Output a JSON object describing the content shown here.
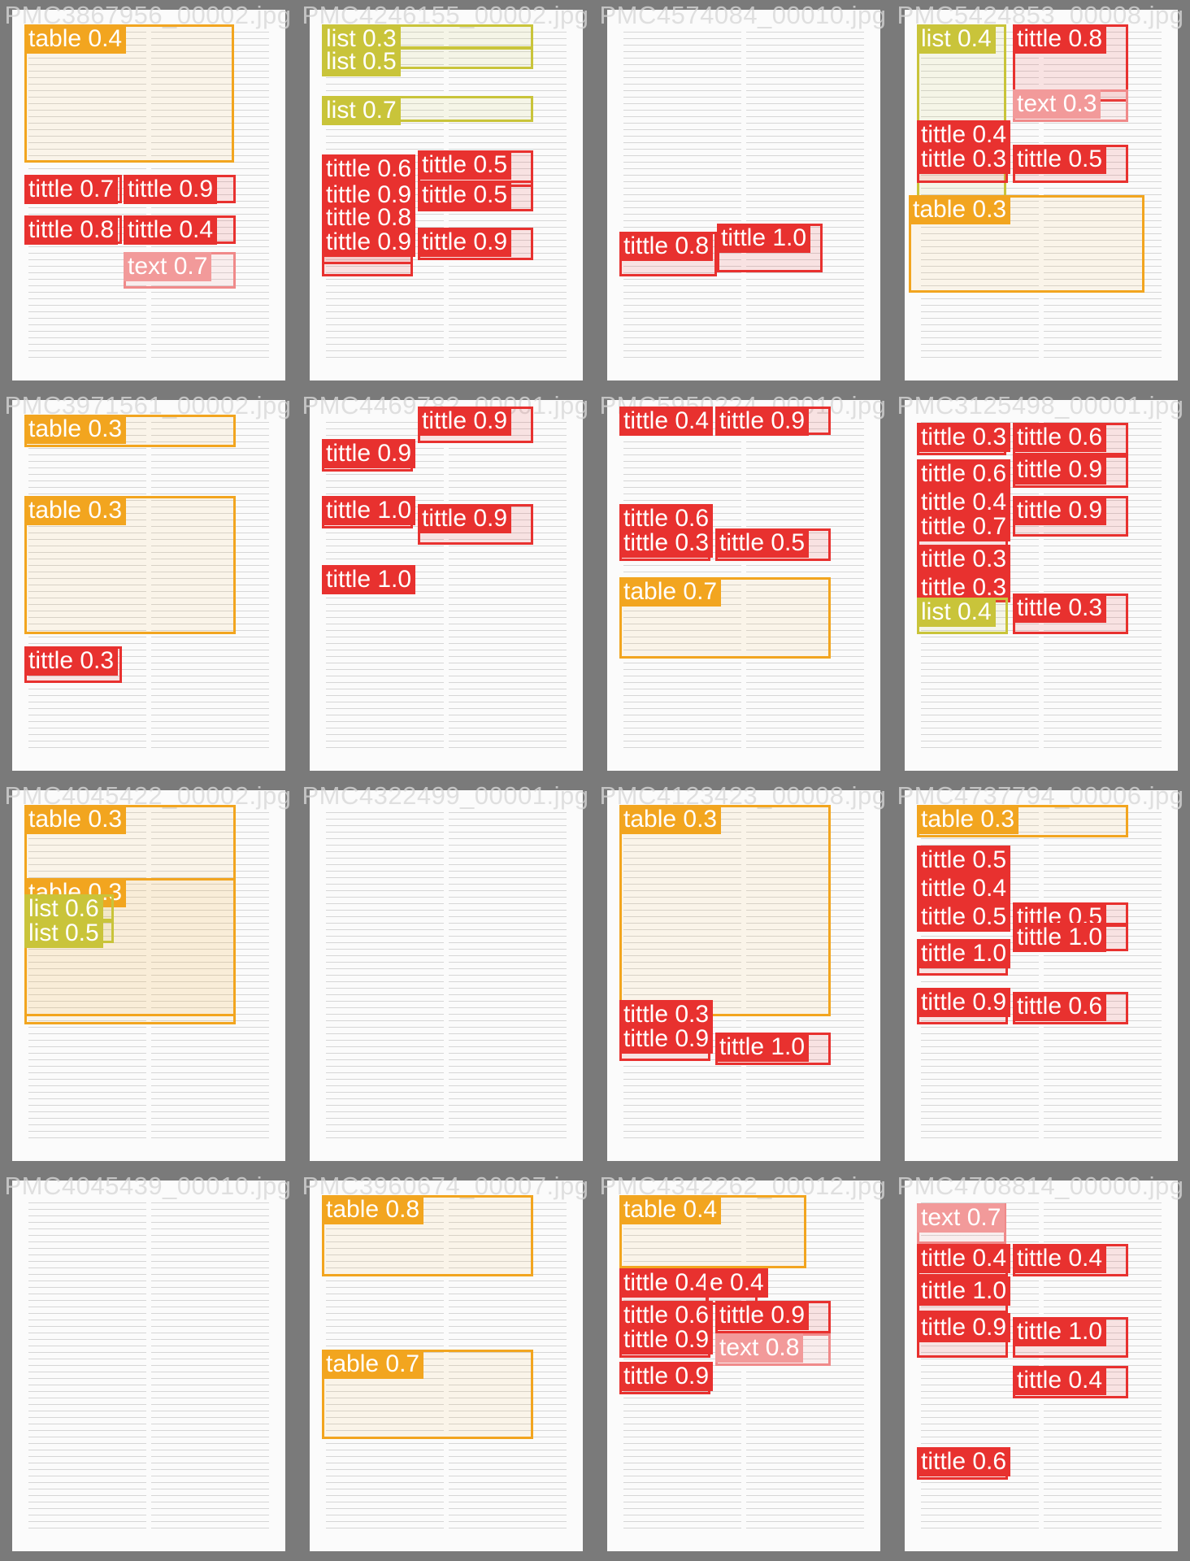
{
  "colors": {
    "title": "#e8312f",
    "table": "#f2a51f",
    "list": "#c9c43a",
    "text": "#f08a8a",
    "cell_background": "#7a7a7a"
  },
  "cells": [
    {
      "name": "PMC3867956_00002.jpg",
      "regions": [
        {
          "label": "table 0.4",
          "class": "orange"
        },
        {
          "label": "tittle 0.7",
          "class": "red"
        },
        {
          "label": "tittle 0.9",
          "class": "red"
        },
        {
          "label": "tittle 0.8",
          "class": "red"
        },
        {
          "label": "tittle 0.4",
          "class": "red"
        },
        {
          "label": "text 0.7",
          "class": "pink"
        }
      ]
    },
    {
      "name": "PMC4246155_00002.jpg",
      "regions": [
        {
          "label": "list 0.3",
          "class": "olive"
        },
        {
          "label": "list 0.5",
          "class": "olive"
        },
        {
          "label": "list 0.7",
          "class": "olive"
        },
        {
          "label": "tittle 0.6",
          "class": "red"
        },
        {
          "label": "tittle 0.5",
          "class": "red"
        },
        {
          "label": "tittle 0.9",
          "class": "red"
        },
        {
          "label": "tittle 0.8",
          "class": "red"
        },
        {
          "label": "tittle 0.9",
          "class": "red"
        },
        {
          "label": "tittle 0.5",
          "class": "red"
        },
        {
          "label": "tittle 0.9",
          "class": "red"
        }
      ]
    },
    {
      "name": "PMC4574084_00010.jpg",
      "regions": [
        {
          "label": "tittle 0.8",
          "class": "red"
        },
        {
          "label": "tittle 1.0",
          "class": "red"
        }
      ]
    },
    {
      "name": "PMC5424853_00008.jpg",
      "regions": [
        {
          "label": "list 0.4",
          "class": "olive"
        },
        {
          "label": "tittle 0.8",
          "class": "red"
        },
        {
          "label": "text 0.3",
          "class": "pink"
        },
        {
          "label": "tittle 0.4",
          "class": "red"
        },
        {
          "label": "tittle 0.3",
          "class": "red"
        },
        {
          "label": "tittle 0.5",
          "class": "red"
        },
        {
          "label": "table 0.3",
          "class": "orange"
        }
      ]
    },
    {
      "name": "PMC3971561_00002.jpg",
      "regions": [
        {
          "label": "table 0.3",
          "class": "orange"
        },
        {
          "label": "table 0.3",
          "class": "orange"
        },
        {
          "label": "tittle 0.3",
          "class": "red"
        }
      ]
    },
    {
      "name": "PMC4469782_00001.jpg",
      "regions": [
        {
          "label": "tittle 0.9",
          "class": "red"
        },
        {
          "label": "tittle 0.9",
          "class": "red"
        },
        {
          "label": "tittle 1.0",
          "class": "red"
        },
        {
          "label": "tittle 0.9",
          "class": "red"
        },
        {
          "label": "tittle 1.0",
          "class": "red"
        }
      ]
    },
    {
      "name": "PMC5950224_00010.jpg",
      "regions": [
        {
          "label": "tittle 0.4",
          "class": "red"
        },
        {
          "label": "tittle 0.9",
          "class": "red"
        },
        {
          "label": "tittle 0.6",
          "class": "red"
        },
        {
          "label": "tittle 0.3",
          "class": "red"
        },
        {
          "label": "tittle 0.5",
          "class": "red"
        },
        {
          "label": "table 0.7",
          "class": "orange"
        }
      ]
    },
    {
      "name": "PMC3125498_00001.jpg",
      "regions": [
        {
          "label": "tittle 0.3",
          "class": "red"
        },
        {
          "label": "tittle 0.6",
          "class": "red"
        },
        {
          "label": "tittle 0.6",
          "class": "red"
        },
        {
          "label": "tittle 0.9",
          "class": "red"
        },
        {
          "label": "tittle 0.4",
          "class": "red"
        },
        {
          "label": "tittle 0.7",
          "class": "red"
        },
        {
          "label": "tittle 0.9",
          "class": "red"
        },
        {
          "label": "tittle 0.3",
          "class": "red"
        },
        {
          "label": "tittle 0.3",
          "class": "red"
        },
        {
          "label": "list 0.4",
          "class": "olive"
        },
        {
          "label": "tittle 0.3",
          "class": "red"
        }
      ]
    },
    {
      "name": "PMC4045422_00002.jpg",
      "regions": [
        {
          "label": "table 0.3",
          "class": "orange"
        },
        {
          "label": "table 0.3",
          "class": "orange"
        },
        {
          "label": "list 0.6",
          "class": "olive"
        },
        {
          "label": "list 0.5",
          "class": "olive"
        }
      ]
    },
    {
      "name": "PMC4322499_00001.jpg",
      "regions": []
    },
    {
      "name": "PMC4123423_00008.jpg",
      "regions": [
        {
          "label": "table 0.3",
          "class": "orange"
        },
        {
          "label": "tittle 0.3",
          "class": "red"
        },
        {
          "label": "tittle 0.9",
          "class": "red"
        },
        {
          "label": "tittle 1.0",
          "class": "red"
        }
      ]
    },
    {
      "name": "PMC4737794_00006.jpg",
      "regions": [
        {
          "label": "table 0.3",
          "class": "orange"
        },
        {
          "label": "tittle 0.5",
          "class": "red"
        },
        {
          "label": "tittle 0.4",
          "class": "red"
        },
        {
          "label": "tittle 0.5",
          "class": "red"
        },
        {
          "label": "tittle 0.5",
          "class": "red"
        },
        {
          "label": "tittle 1.0",
          "class": "red"
        },
        {
          "label": "tittle 1.0",
          "class": "red"
        },
        {
          "label": "tittle 0.9",
          "class": "red"
        },
        {
          "label": "tittle 0.6",
          "class": "red"
        }
      ]
    },
    {
      "name": "PMC4045439_00010.jpg",
      "regions": []
    },
    {
      "name": "PMC3960674_00007.jpg",
      "regions": [
        {
          "label": "table 0.8",
          "class": "orange"
        },
        {
          "label": "table 0.7",
          "class": "orange"
        }
      ]
    },
    {
      "name": "PMC4342262_00012.jpg",
      "regions": [
        {
          "label": "table 0.4",
          "class": "orange"
        },
        {
          "label": "tittle 0.4",
          "class": "red"
        },
        {
          "label": "e 0.4",
          "class": "red"
        },
        {
          "label": "tittle 0.6",
          "class": "red"
        },
        {
          "label": "tittle 0.9",
          "class": "red"
        },
        {
          "label": "tittle 0.9",
          "class": "red"
        },
        {
          "label": "text 0.8",
          "class": "pink"
        },
        {
          "label": "tittle 0.9",
          "class": "red"
        }
      ]
    },
    {
      "name": "PMC4708814_00000.jpg",
      "regions": [
        {
          "label": "text 0.7",
          "class": "pink"
        },
        {
          "label": "tittle 0.4",
          "class": "red"
        },
        {
          "label": "tittle 0.4",
          "class": "red"
        },
        {
          "label": "tittle 1.0",
          "class": "red"
        },
        {
          "label": "tittle 0.9",
          "class": "red"
        },
        {
          "label": "tittle 1.0",
          "class": "red"
        },
        {
          "label": "tittle 0.4",
          "class": "red"
        },
        {
          "label": "tittle 0.6",
          "class": "red"
        }
      ]
    }
  ]
}
